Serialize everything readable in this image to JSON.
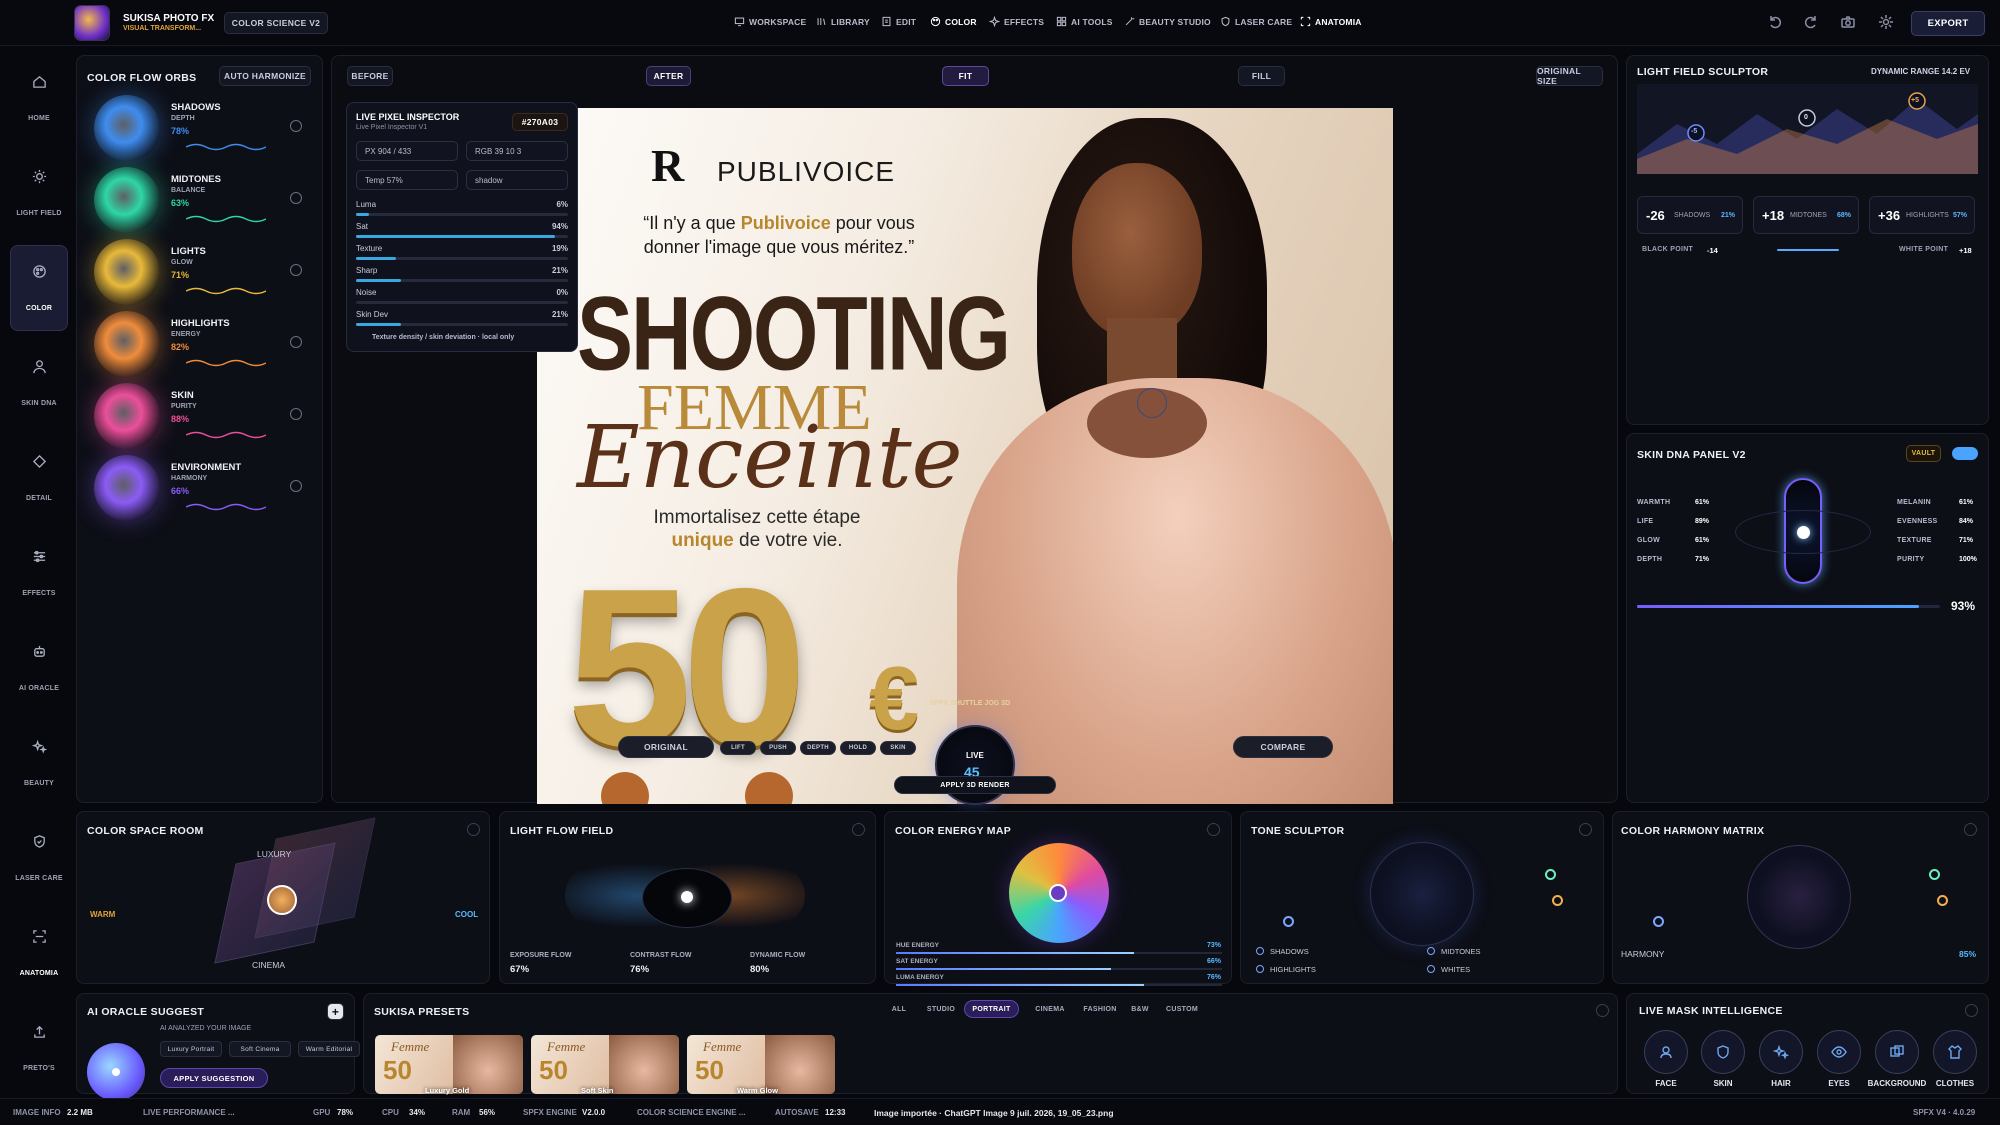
{
  "app": {
    "name": "SUKISA PHOTO FX",
    "subtitle": "VISUAL TRANSFORM...",
    "badge": "COLOR SCIENCE V2",
    "export_label": "EXPORT"
  },
  "nav": [
    {
      "label": "WORKSPACE",
      "icon": "monitor-icon"
    },
    {
      "label": "LIBRARY",
      "icon": "library-icon"
    },
    {
      "label": "EDIT",
      "icon": "edit-icon"
    },
    {
      "label": "COLOR",
      "icon": "palette-icon",
      "active": true
    },
    {
      "label": "EFFECTS",
      "icon": "sparkles-icon"
    },
    {
      "label": "AI TOOLS",
      "icon": "grid-icon"
    },
    {
      "label": "BEAUTY STUDIO",
      "icon": "wand-icon"
    },
    {
      "label": "LASER CARE",
      "icon": "shield-icon"
    },
    {
      "label": "ANATOMIA",
      "icon": "scan-icon"
    }
  ],
  "sidebar": [
    {
      "label": "HOME",
      "icon": "home-icon"
    },
    {
      "label": "LIGHT FIELD",
      "icon": "sun-icon"
    },
    {
      "label": "COLOR",
      "icon": "palette-icon",
      "active": true
    },
    {
      "label": "SKIN DNA",
      "icon": "user-icon"
    },
    {
      "label": "DETAIL",
      "icon": "diamond-icon"
    },
    {
      "label": "EFFECTS",
      "icon": "sliders-icon"
    },
    {
      "label": "AI ORACLE",
      "icon": "robot-icon"
    },
    {
      "label": "BEAUTY",
      "icon": "sparkles-icon"
    },
    {
      "label": "LASER CARE",
      "icon": "shield-icon"
    },
    {
      "label": "ANATOMIA",
      "icon": "scan-icon"
    },
    {
      "label": "PRETO'S",
      "icon": "upload-icon"
    }
  ],
  "orbs": {
    "title": "COLOR FLOW ORBS",
    "auto_label": "AUTO HARMONIZE",
    "items": [
      {
        "name": "SHADOWS",
        "sub": "DEPTH",
        "value": "78%",
        "color": "#3f8df0"
      },
      {
        "name": "MIDTONES",
        "sub": "BALANCE",
        "value": "63%",
        "color": "#2fd6a6"
      },
      {
        "name": "LIGHTS",
        "sub": "GLOW",
        "value": "71%",
        "color": "#e8b93a"
      },
      {
        "name": "HIGHLIGHTS",
        "sub": "ENERGY",
        "value": "82%",
        "color": "#ef8c3c"
      },
      {
        "name": "SKIN",
        "sub": "PURITY",
        "value": "88%",
        "color": "#ec4f9a"
      },
      {
        "name": "ENVIRONMENT",
        "sub": "HARMONY",
        "value": "66%",
        "color": "#8b5cf6"
      }
    ]
  },
  "viewer": {
    "before": "BEFORE",
    "after": "AFTER",
    "fit": "FIT",
    "fill": "FILL",
    "original_size": "ORIGINAL SIZE"
  },
  "inspector": {
    "title": "LIVE PIXEL INSPECTOR",
    "subtitle": "Live Pixel Inspector V1",
    "hex": "#270A03",
    "px": "PX 904 / 433",
    "rgb": "RGB 39 10 3",
    "temp": "Temp 57%",
    "zone": "shadow",
    "rows": [
      {
        "label": "Luma",
        "value": "6%",
        "pct": 6
      },
      {
        "label": "Sat",
        "value": "94%",
        "pct": 94
      },
      {
        "label": "Texture",
        "value": "19%",
        "pct": 19
      },
      {
        "label": "Sharp",
        "value": "21%",
        "pct": 21
      },
      {
        "label": "Noise",
        "value": "0%",
        "pct": 0
      },
      {
        "label": "Skin Dev",
        "value": "21%",
        "pct": 21
      }
    ],
    "footer": "Texture density / skin deviation · local only"
  },
  "poster": {
    "brand": "PUBLIVOICE",
    "quote_a": "“Il n'y a que ",
    "quote_brand": "Publivoice",
    "quote_b": " pour vous",
    "quote_c": "donner l'image que vous méritez.”",
    "headline": "SHOOTING",
    "line2": "FEMME",
    "line3": "Enceinte",
    "tag_a": "Immortalisez cette étape",
    "tag_b": "unique",
    "tag_c": " de votre vie.",
    "price": "50",
    "currency": "€"
  },
  "overlay": {
    "original": "ORIGINAL",
    "chips": [
      "LIFT",
      "PUSH",
      "DEPTH",
      "HOLD",
      "SKIN"
    ],
    "shuttle": "SPFX SHUTTLE JOG 3D",
    "live": "LIVE",
    "live_value": "45",
    "apply_3d": "APPLY 3D RENDER",
    "compare": "COMPARE"
  },
  "light_field": {
    "title": "LIGHT FIELD SCULPTOR",
    "range": "DYNAMIC RANGE 14.2 EV",
    "markers": [
      "-5",
      "0",
      "+5"
    ],
    "stats": [
      {
        "value": "-26",
        "label": "SHADOWS",
        "pct": "21%"
      },
      {
        "value": "+18",
        "label": "MIDTONES",
        "pct": "68%"
      },
      {
        "value": "+36",
        "label": "HIGHLIGHTS",
        "pct": "57%"
      }
    ],
    "black_label": "BLACK POINT",
    "black": "-14",
    "white_label": "WHITE POINT",
    "white": "+18"
  },
  "skin_dna": {
    "title": "SKIN DNA PANEL V2",
    "vault": "VAULT",
    "left": [
      {
        "k": "WARMTH",
        "v": "61%"
      },
      {
        "k": "LIFE",
        "v": "89%"
      },
      {
        "k": "GLOW",
        "v": "61%"
      },
      {
        "k": "DEPTH",
        "v": "71%"
      }
    ],
    "right": [
      {
        "k": "MELANIN",
        "v": "61%"
      },
      {
        "k": "EVENNESS",
        "v": "84%"
      },
      {
        "k": "TEXTURE",
        "v": "71%"
      },
      {
        "k": "PURITY",
        "v": "100%"
      }
    ],
    "score": "93%",
    "score_pct": 93
  },
  "color_space": {
    "title": "COLOR SPACE ROOM",
    "warm": "WARM",
    "cool": "COOL",
    "luxury": "LUXURY",
    "cinema": "CINEMA"
  },
  "light_flow": {
    "title": "LIGHT FLOW FIELD",
    "stats": [
      {
        "k": "EXPOSURE FLOW",
        "v": "67%"
      },
      {
        "k": "CONTRAST FLOW",
        "v": "76%"
      },
      {
        "k": "DYNAMIC FLOW",
        "v": "80%"
      }
    ]
  },
  "energy": {
    "title": "COLOR ENERGY MAP",
    "rows": [
      {
        "k": "HUE ENERGY",
        "v": "73%",
        "pct": 73
      },
      {
        "k": "SAT ENERGY",
        "v": "66%",
        "pct": 66
      },
      {
        "k": "LUMA ENERGY",
        "v": "76%",
        "pct": 76
      }
    ]
  },
  "tone": {
    "title": "TONE SCULPTOR",
    "legend": [
      "SHADOWS",
      "MIDTONES",
      "HIGHLIGHTS",
      "WHITES"
    ]
  },
  "harmony": {
    "title": "COLOR HARMONY MATRIX",
    "label": "HARMONY",
    "value": "85%"
  },
  "oracle": {
    "title": "AI ORACLE SUGGEST",
    "analyzed": "AI ANALYZED YOUR IMAGE",
    "chips": [
      "Luxury Portrait",
      "Soft Cinema",
      "Warm Editorial"
    ],
    "apply": "APPLY SUGGESTION",
    "plus": "+"
  },
  "presets": {
    "title": "SUKISA PRESETS",
    "tabs": [
      "ALL",
      "STUDIO",
      "PORTRAIT",
      "CINEMA",
      "FASHION",
      "B&W",
      "CUSTOM"
    ],
    "active": "PORTRAIT",
    "items": [
      "Luxury Gold",
      "Soft Skin",
      "Warm Glow"
    ]
  },
  "mask": {
    "title": "LIVE MASK INTELLIGENCE",
    "items": [
      {
        "label": "FACE",
        "icon": "face-icon"
      },
      {
        "label": "SKIN",
        "icon": "shield-icon"
      },
      {
        "label": "HAIR",
        "icon": "sparkles-icon"
      },
      {
        "label": "EYES",
        "icon": "eye-icon"
      },
      {
        "label": "BACKGROUND",
        "icon": "layers-icon"
      },
      {
        "label": "CLOTHES",
        "icon": "shirt-icon"
      }
    ]
  },
  "status": {
    "image_info_label": "IMAGE INFO",
    "image_info": "2.2 MB",
    "live_perf": "LIVE PERFORMANCE ...",
    "gpu_label": "GPU",
    "gpu": "78%",
    "cpu_label": "CPU",
    "cpu": "34%",
    "ram_label": "RAM",
    "ram": "56%",
    "engine_label": "SPFX ENGINE",
    "engine": "V2.0.0",
    "color_engine": "COLOR SCIENCE ENGINE ...",
    "autosave_label": "AUTOSAVE",
    "autosave": "12:33",
    "file": "Image importée · ChatGPT Image 9 juil. 2026, 19_05_23.png",
    "version": "SPFX V4 · 4.0.29"
  }
}
